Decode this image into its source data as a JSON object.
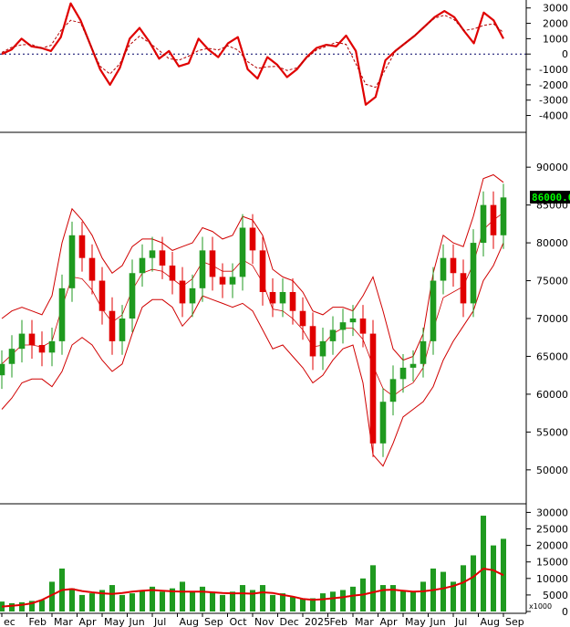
{
  "colors": {
    "up": "#1f9a1f",
    "down": "#e00000",
    "macd": "#e00000",
    "signal": "#b00000",
    "band": "#d00000",
    "ma": "#e00000",
    "volume": "#1f9a1f",
    "frame": "#000000",
    "tag_bg": "#000000",
    "tag_fg": "#00ff00"
  },
  "chart_data": [
    {
      "type": "line",
      "panel": "oscillator",
      "y_ticks": [
        "3000",
        "2000",
        "1000",
        "0",
        "-1000",
        "-2000",
        "-3000",
        "-4000"
      ],
      "y_tick_values": [
        3000,
        2000,
        1000,
        0,
        -1000,
        -2000,
        -3000,
        -4000
      ],
      "ylim": [
        -4800,
        3400
      ],
      "x_months": [
        "ec",
        "Feb",
        "Mar",
        "Apr",
        "May",
        "Jun",
        "Jul",
        "Aug",
        "Sep",
        "Oct",
        "Nov",
        "Dec",
        "2025",
        "Feb",
        "Mar",
        "Apr",
        "May",
        "Jun",
        "Jul",
        "Aug",
        "Sep"
      ],
      "series": [
        {
          "values": [
            0,
            300,
            1000,
            500,
            400,
            200,
            1100,
            3300,
            2200,
            600,
            -1000,
            -2000,
            -900,
            1000,
            1700,
            800,
            -300,
            200,
            -800,
            -600,
            1000,
            300,
            -200,
            700,
            1100,
            -1000,
            -1600,
            -200,
            -700,
            -1500,
            -1000,
            -200,
            400,
            600,
            500,
            1200,
            200,
            -3300,
            -2800,
            -400,
            200,
            700,
            1200,
            1800,
            2400,
            2800,
            2400,
            1500,
            700,
            2700,
            2200,
            1000
          ]
        }
      ]
    },
    {
      "type": "candlestick",
      "panel": "price",
      "y_ticks": [
        "90000",
        "85000",
        "80000",
        "75000",
        "70000",
        "65000",
        "60000",
        "55000",
        "50000"
      ],
      "y_tick_values": [
        90000,
        85000,
        80000,
        75000,
        70000,
        65000,
        60000,
        55000,
        50000
      ],
      "ylim": [
        46000,
        94000
      ],
      "last_price": "86000.00",
      "close": [
        64000,
        66000,
        68000,
        66500,
        65500,
        67000,
        74000,
        81000,
        78000,
        75000,
        71000,
        67000,
        70000,
        76000,
        78000,
        79000,
        77000,
        75000,
        72000,
        74000,
        79000,
        75500,
        74500,
        75500,
        82000,
        79000,
        73500,
        72000,
        73500,
        71000,
        69000,
        65000,
        67000,
        68500,
        69500,
        70000,
        68000,
        53500,
        59000,
        62000,
        63500,
        64000,
        67000,
        75000,
        78000,
        76000,
        72000,
        80000,
        85000,
        81000,
        86000
      ],
      "bollinger_upper": [
        70000,
        71000,
        71500,
        71000,
        70500,
        73000,
        80000,
        84500,
        83000,
        81000,
        78000,
        76000,
        77000,
        79500,
        80500,
        80500,
        80000,
        79000,
        79500,
        80000,
        82000,
        81500,
        80500,
        81000,
        83500,
        83000,
        81000,
        76500,
        75500,
        75000,
        73500,
        71000,
        70500,
        71500,
        71500,
        71000,
        73000,
        75500,
        71000,
        66000,
        64500,
        65000,
        68000,
        76000,
        81000,
        80000,
        79500,
        83500,
        88500,
        89000,
        88000
      ],
      "bollinger_lower": [
        58000,
        59500,
        61500,
        62000,
        62000,
        61000,
        63000,
        66500,
        67500,
        66500,
        64500,
        63000,
        64000,
        68000,
        71500,
        72500,
        72500,
        71500,
        69000,
        70500,
        73000,
        72500,
        72000,
        71500,
        72000,
        71000,
        68500,
        66000,
        66500,
        65000,
        63500,
        61500,
        62500,
        64500,
        66000,
        66500,
        61500,
        52000,
        50500,
        53500,
        57000,
        58000,
        59000,
        61000,
        64500,
        67000,
        69000,
        71000,
        75000,
        77000,
        80000
      ]
    },
    {
      "type": "bar",
      "panel": "volume",
      "y_ticks": [
        "30000",
        "25000",
        "20000",
        "15000",
        "10000",
        "5000",
        "0"
      ],
      "y_tick_values": [
        30000,
        25000,
        20000,
        15000,
        10000,
        5000,
        0
      ],
      "ylim": [
        0,
        31500
      ],
      "unit_label": "x1000",
      "values": [
        3000,
        2500,
        2800,
        3200,
        3500,
        9000,
        13000,
        7000,
        5000,
        5500,
        6500,
        8000,
        5000,
        5500,
        6500,
        7500,
        6000,
        7000,
        9000,
        6000,
        7500,
        6000,
        5000,
        6000,
        8000,
        6500,
        8000,
        5000,
        5500,
        4500,
        4000,
        4000,
        5500,
        6000,
        6500,
        7500,
        10000,
        14000,
        8000,
        8000,
        6500,
        6000,
        9000,
        13000,
        12000,
        9000,
        14000,
        17000,
        29000,
        20000,
        22000
      ],
      "ma": [
        1500,
        1700,
        2000,
        2500,
        3500,
        5000,
        6500,
        6800,
        6200,
        5800,
        5500,
        5300,
        5600,
        6000,
        6300,
        6500,
        6300,
        6100,
        6000,
        6000,
        6000,
        5800,
        5600,
        5500,
        5500,
        5400,
        5800,
        5600,
        5000,
        4500,
        3800,
        3500,
        3700,
        4000,
        4300,
        4800,
        5100,
        5800,
        6500,
        6600,
        6300,
        6000,
        6100,
        6500,
        7000,
        7700,
        8800,
        10500,
        13000,
        12500,
        11000
      ]
    }
  ]
}
